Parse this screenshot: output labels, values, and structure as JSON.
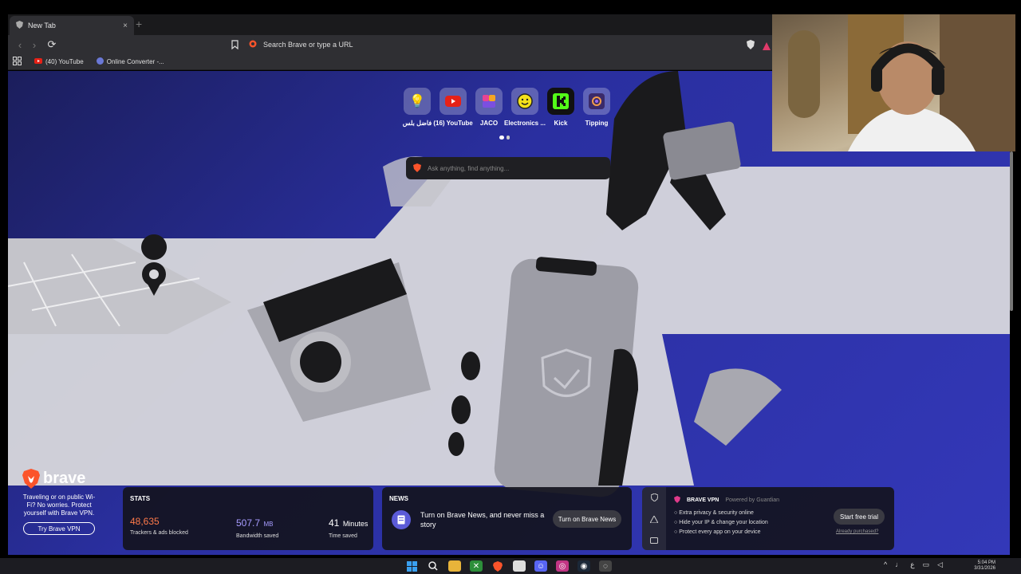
{
  "browser": {
    "tab_title": "New Tab",
    "tab_close": "×",
    "new_tab": "+",
    "back": "‹",
    "forward": "›",
    "reload": "⟳",
    "url_placeholder": "Search Brave or type a URL"
  },
  "bookmarks": [
    {
      "label": "(40) YouTube",
      "icon": "youtube-icon"
    },
    {
      "label": "Online Converter -...",
      "icon": "converter-icon"
    }
  ],
  "top_sites": [
    {
      "label": "فاضل بلس",
      "glyph": "💡",
      "color": "#f2c14e"
    },
    {
      "label": "(16) YouTube",
      "glyph": "▶",
      "color": "#e62117"
    },
    {
      "label": "JACO",
      "glyph": "❖",
      "color": "#7b4fe0"
    },
    {
      "label": "Electronics ...",
      "glyph": "☺",
      "color": "#f4e01a"
    },
    {
      "label": "Kick",
      "glyph": "K",
      "color": "#53fc18"
    },
    {
      "label": "Tipping",
      "glyph": "◆",
      "color": "#3a2a6a"
    }
  ],
  "search": {
    "placeholder": "Ask anything, find anything..."
  },
  "promo": {
    "brand": "brave",
    "text": "Traveling or on public Wi-Fi? No worries. Protect yourself with Brave VPN.",
    "button": "Try Brave VPN"
  },
  "stats": {
    "heading": "STATS",
    "trackers_value": "48,635",
    "trackers_label": "Trackers & ads blocked",
    "bandwidth_value": "507.7",
    "bandwidth_unit": "MB",
    "bandwidth_label": "Bandwidth saved",
    "time_value": "41",
    "time_unit": "Minutes",
    "time_label": "Time saved"
  },
  "news": {
    "heading": "NEWS",
    "message": "Turn on Brave News, and never miss a story",
    "button": "Turn on Brave News"
  },
  "vpn": {
    "heading": "BRAVE VPN",
    "powered": "Powered by Guardian",
    "features": [
      "Extra privacy & security online",
      "Hide your IP & change your location",
      "Protect every app on your device"
    ],
    "button": "Start free trial",
    "link": "Already purchased?"
  },
  "taskbar": {
    "time": "5:04 PM",
    "date": "3/31/2026",
    "lang": "ع"
  },
  "colors": {
    "accent_blue": "#3338b8",
    "stats_orange": "#ff7a4a",
    "stats_purple": "#a79cff",
    "brave_orange": "#fb542b"
  }
}
